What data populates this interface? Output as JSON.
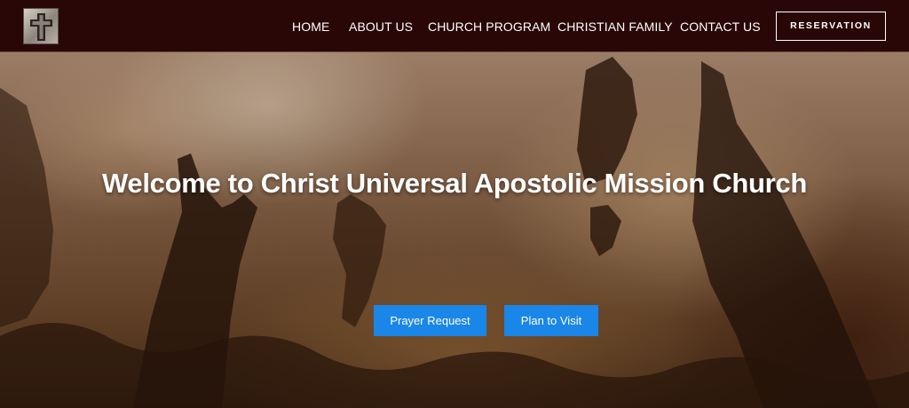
{
  "header": {
    "logo_icon": "cross-logo-icon",
    "nav": [
      {
        "label": "HOME"
      },
      {
        "label": "ABOUT US"
      },
      {
        "label": "CHURCH PROGRAM"
      },
      {
        "label": "CHRISTIAN FAMILY"
      },
      {
        "label": "CONTACT US"
      }
    ],
    "reservation_label": "RESERVATION",
    "background_color": "#2a0707"
  },
  "hero": {
    "title": "Welcome to Christ Universal Apostolic Mission Church",
    "buttons": [
      {
        "label": "Prayer Request"
      },
      {
        "label": "Plan to Visit"
      }
    ],
    "button_color": "#1a86e8"
  }
}
